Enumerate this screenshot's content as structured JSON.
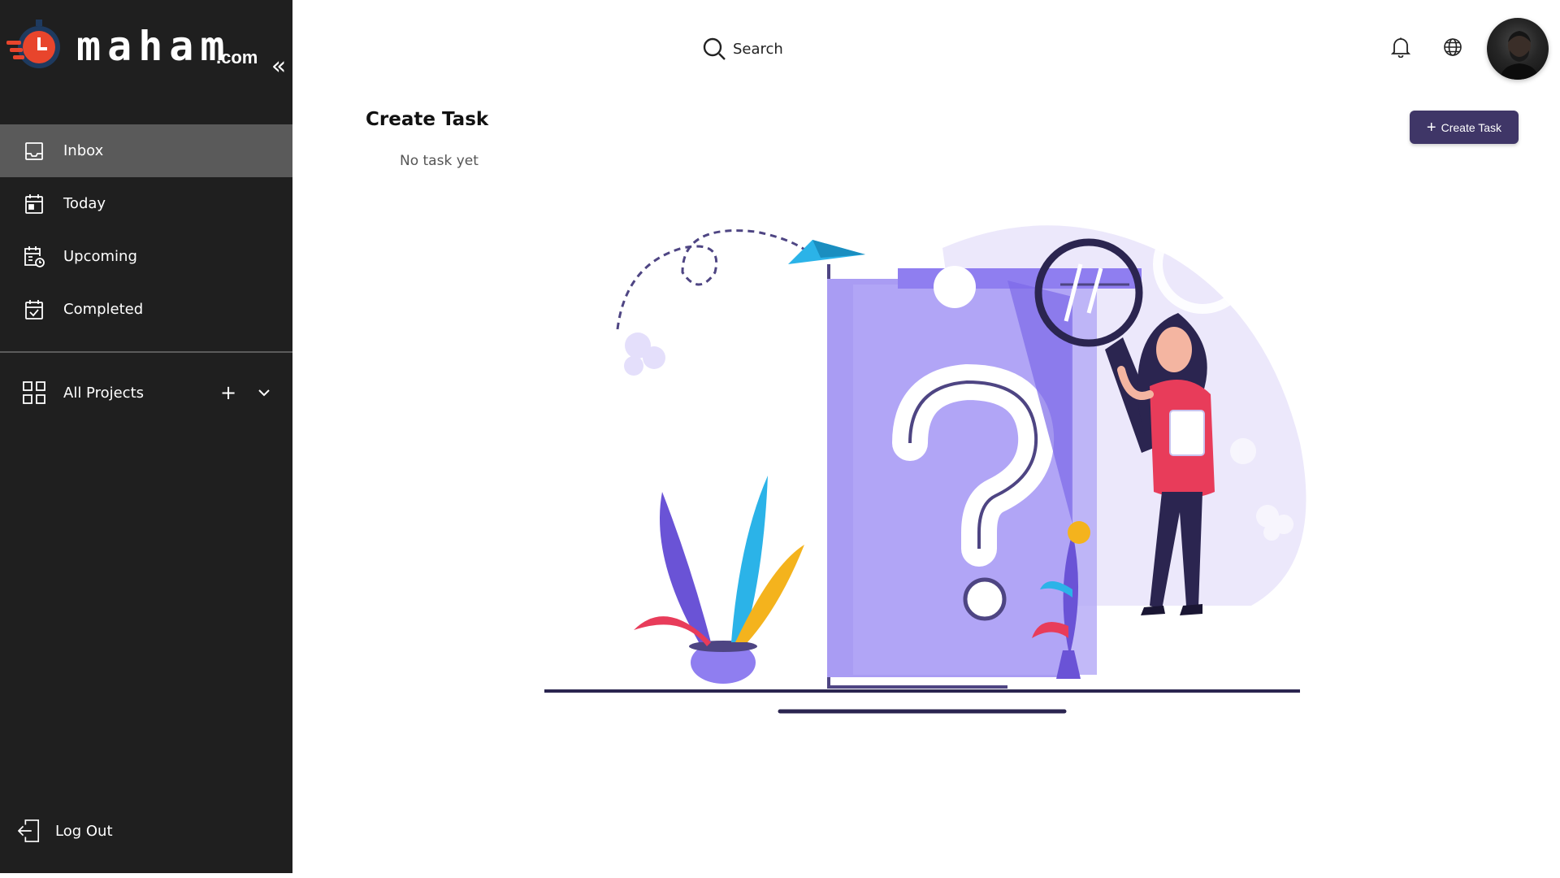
{
  "brand": {
    "name": "maham",
    "tld": ".com"
  },
  "sidebar": {
    "items": [
      {
        "label": "Inbox",
        "icon": "inbox-icon",
        "active": true
      },
      {
        "label": "Today",
        "icon": "calendar-today-icon",
        "active": false
      },
      {
        "label": "Upcoming",
        "icon": "calendar-upcoming-icon",
        "active": false
      },
      {
        "label": "Completed",
        "icon": "calendar-check-icon",
        "active": false
      }
    ],
    "projects_label": "All Projects",
    "logout_label": "Log Out"
  },
  "header": {
    "search_label": "Search"
  },
  "main": {
    "title": "Create Task",
    "empty_text": "No task yet",
    "create_button_label": "Create Task"
  },
  "colors": {
    "sidebar_bg": "#1f1f1f",
    "active_item_bg": "#5a5a5a",
    "accent": "#3f3667",
    "illustration_purple": "#9b8cf2",
    "logo_red": "#e8452c"
  }
}
